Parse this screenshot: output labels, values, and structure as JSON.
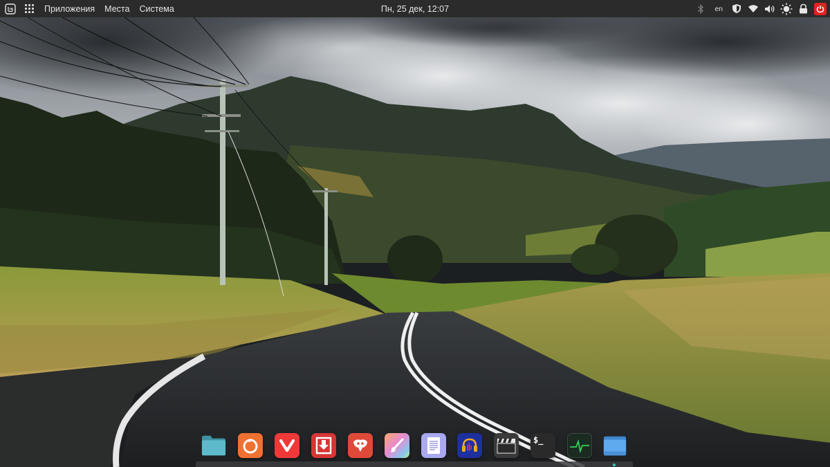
{
  "top_panel": {
    "menu": {
      "applications": "Приложения",
      "places": "Места",
      "system": "Система"
    },
    "clock": "Пн, 25 дек, 12:07",
    "keyboard_layout": "en",
    "tray_icons": [
      "bluetooth-icon",
      "shield-icon",
      "wifi-icon",
      "volume-icon",
      "brightness-icon",
      "lock-icon",
      "power-icon"
    ],
    "colors": {
      "panel": "#2b2b2b",
      "power": "#e52020"
    }
  },
  "dock": {
    "apps": [
      {
        "name": "files",
        "icon": "folder-icon",
        "color": "#4aa8b8"
      },
      {
        "name": "firefox",
        "icon": "firefox-icon",
        "color": "#f06a2a"
      },
      {
        "name": "vivaldi",
        "icon": "vivaldi-icon",
        "color": "#ef3939"
      },
      {
        "name": "downloader",
        "icon": "download-icon",
        "color": "#d83a3a"
      },
      {
        "name": "gimp",
        "icon": "gimp-icon",
        "color": "#e2493a"
      },
      {
        "name": "paint",
        "icon": "paintbrush-icon",
        "color": "#e8a0d0"
      },
      {
        "name": "text-editor",
        "icon": "document-icon",
        "color": "#a9a9f0"
      },
      {
        "name": "audacity",
        "icon": "audacity-icon",
        "color": "#1e2f9e"
      },
      {
        "name": "video-editor",
        "icon": "clapperboard-icon",
        "color": "#3a3a3a"
      },
      {
        "name": "terminal",
        "icon": "terminal-icon",
        "color": "#2a2a2a"
      },
      {
        "name": "system-monitor",
        "icon": "monitor-icon",
        "color": "#1f3a2a"
      },
      {
        "name": "file-manager",
        "icon": "folder-blue-icon",
        "color": "#4f9ee6"
      }
    ],
    "terminal_prompt": "$_"
  }
}
